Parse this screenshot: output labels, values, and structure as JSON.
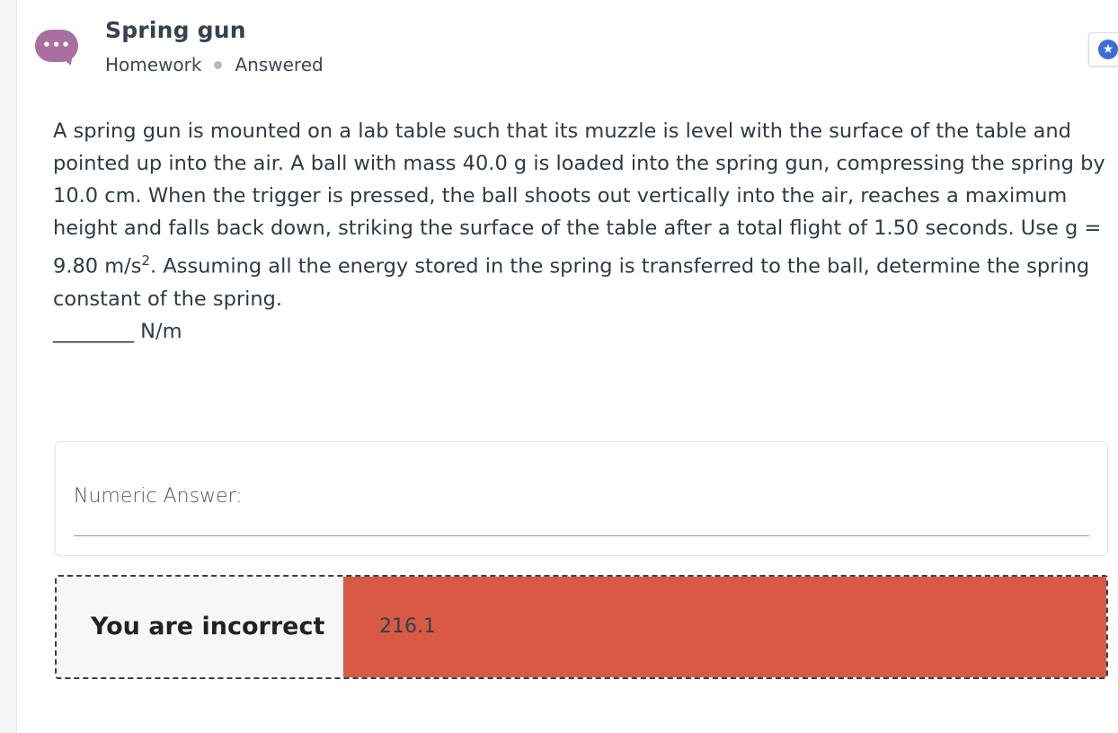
{
  "header": {
    "title": "Spring gun",
    "type": "Homework",
    "status": "Answered",
    "chat_icon": "chat-bubble-icon",
    "chat_dots": "•••",
    "star_icon": "star-badge-icon",
    "star_glyph": "★"
  },
  "question": {
    "text_main": "A spring gun is mounted on a lab table such that its muzzle is level with the surface of the table and pointed up into the air. A ball with mass 40.0 g is loaded into the spring gun, compressing the spring by 10.0 cm. When the trigger is pressed, the ball shoots out vertically into the air, reaches a maximum height and falls back down, striking the surface of the table after a total flight of 1.50 seconds. Use g = 9.80 m/s",
    "superscript": "2",
    "text_end": ". Assuming all the energy stored in the spring is transferred to the ball, determine the spring constant of the spring.",
    "blank_line": "________ N/m"
  },
  "answer": {
    "label": "Numeric Answer:"
  },
  "result": {
    "status": "You are incorrect",
    "value": "216.1",
    "color": "#d85a45"
  }
}
